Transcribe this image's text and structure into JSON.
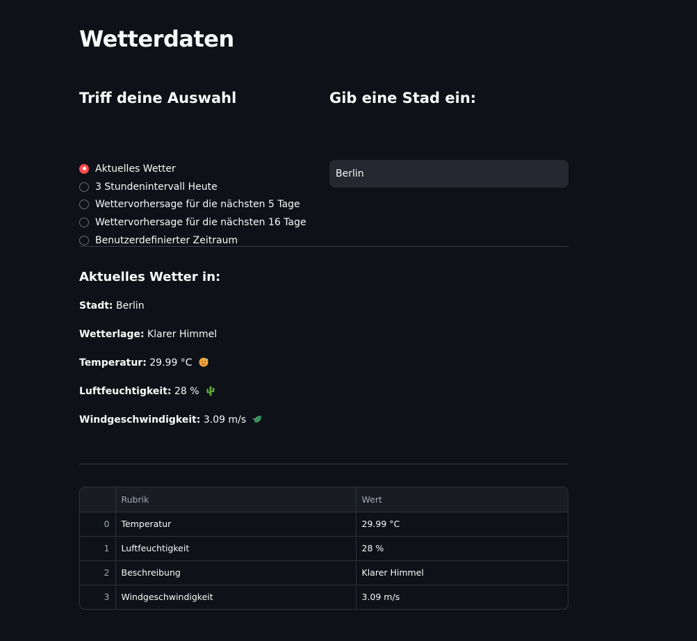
{
  "page": {
    "title": "Wetterdaten"
  },
  "selection": {
    "heading": "Triff deine Auswahl",
    "options": [
      {
        "label": "Aktuelles Wetter",
        "checked": true
      },
      {
        "label": "3 Stundenintervall Heute",
        "checked": false
      },
      {
        "label": "Wettervorhersage für die nächsten 5 Tage",
        "checked": false
      },
      {
        "label": "Wettervorhersage für die nächsten 16 Tage",
        "checked": false
      },
      {
        "label": "Benutzerdefinierter Zeitraum",
        "checked": false
      }
    ]
  },
  "city_input": {
    "heading": "Gib eine Stad ein:",
    "value": "Berlin"
  },
  "current_weather": {
    "heading": "Aktuelles Wetter in:",
    "city_label": "Stadt:",
    "city_value": "Berlin",
    "condition_label": "Wetterlage:",
    "condition_value": "Klarer Himmel",
    "temperature_label": "Temperatur:",
    "temperature_value": "29.99 °C",
    "temperature_icon": "hot-face-icon",
    "humidity_label": "Luftfeuchtigkeit:",
    "humidity_value": "28 %",
    "humidity_icon": "cactus-icon",
    "wind_label": "Windgeschwindigkeit:",
    "wind_value": "3.09 m/s",
    "wind_icon": "leaf-wind-icon"
  },
  "table": {
    "headers": [
      "",
      "Rubrik",
      "Wert"
    ],
    "rows": [
      {
        "index": "0",
        "rubrik": "Temperatur",
        "wert": "29.99 °C"
      },
      {
        "index": "1",
        "rubrik": "Luftfeuchtigkeit",
        "wert": "28 %"
      },
      {
        "index": "2",
        "rubrik": "Beschreibung",
        "wert": "Klarer Himmel"
      },
      {
        "index": "3",
        "rubrik": "Windgeschwindigkeit",
        "wert": "3.09 m/s"
      }
    ]
  },
  "colors": {
    "background": "#0e1117",
    "accent": "#ff4b4b",
    "input_bg": "#262730"
  }
}
